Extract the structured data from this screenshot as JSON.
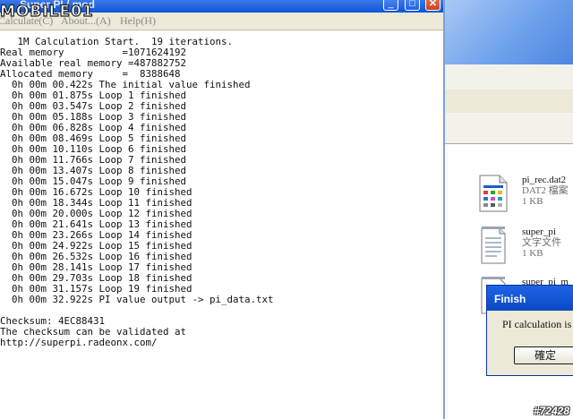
{
  "window": {
    "title": "Super PI / mod",
    "minimize_label": "_",
    "maximize_label": "□",
    "close_label": "✕",
    "menu": [
      {
        "label": "Calculate(C)"
      },
      {
        "label": "About...(A)"
      },
      {
        "label": "Help(H)"
      }
    ]
  },
  "watermark_logo": "MOBILE01",
  "output_lines": [
    "   1M Calculation Start.  19 iterations.",
    "Real memory          =1071624192",
    "Available real memory =487882752",
    "Allocated memory     =  8388648",
    "  0h 00m 00.422s The initial value finished",
    "  0h 00m 01.875s Loop 1 finished",
    "  0h 00m 03.547s Loop 2 finished",
    "  0h 00m 05.188s Loop 3 finished",
    "  0h 00m 06.828s Loop 4 finished",
    "  0h 00m 08.469s Loop 5 finished",
    "  0h 00m 10.110s Loop 6 finished",
    "  0h 00m 11.766s Loop 7 finished",
    "  0h 00m 13.407s Loop 8 finished",
    "  0h 00m 15.047s Loop 9 finished",
    "  0h 00m 16.672s Loop 10 finished",
    "  0h 00m 18.344s Loop 11 finished",
    "  0h 00m 20.000s Loop 12 finished",
    "  0h 00m 21.641s Loop 13 finished",
    "  0h 00m 23.266s Loop 14 finished",
    "  0h 00m 24.922s Loop 15 finished",
    "  0h 00m 26.532s Loop 16 finished",
    "  0h 00m 28.141s Loop 17 finished",
    "  0h 00m 29.703s Loop 18 finished",
    "  0h 00m 31.157s Loop 19 finished",
    "  0h 00m 32.922s PI value output -> pi_data.txt",
    "",
    "Checksum: 4EC88431",
    "The checksum can be validated at",
    "http://superpi.radeonx.com/"
  ],
  "explorer": {
    "files": [
      {
        "name": "pi_rec.dat2",
        "type": "DAT2 檔案",
        "size": "1 KB",
        "icon": "data-file-icon"
      },
      {
        "name": "super_pi",
        "type": "文字文件",
        "size": "1 KB",
        "icon": "text-file-icon"
      },
      {
        "name": "super_pi_m",
        "type": "",
        "size": "",
        "icon": "text-file-icon"
      }
    ]
  },
  "dialog": {
    "title": "Finish",
    "message": "PI calculation is c",
    "ok_label": "確定"
  },
  "watermark_id": "#72428",
  "colors": {
    "titlebar_blue": "#0b56d8",
    "dialog_titlebar": "#0a49c6",
    "panel_gray": "#ece9d8"
  }
}
